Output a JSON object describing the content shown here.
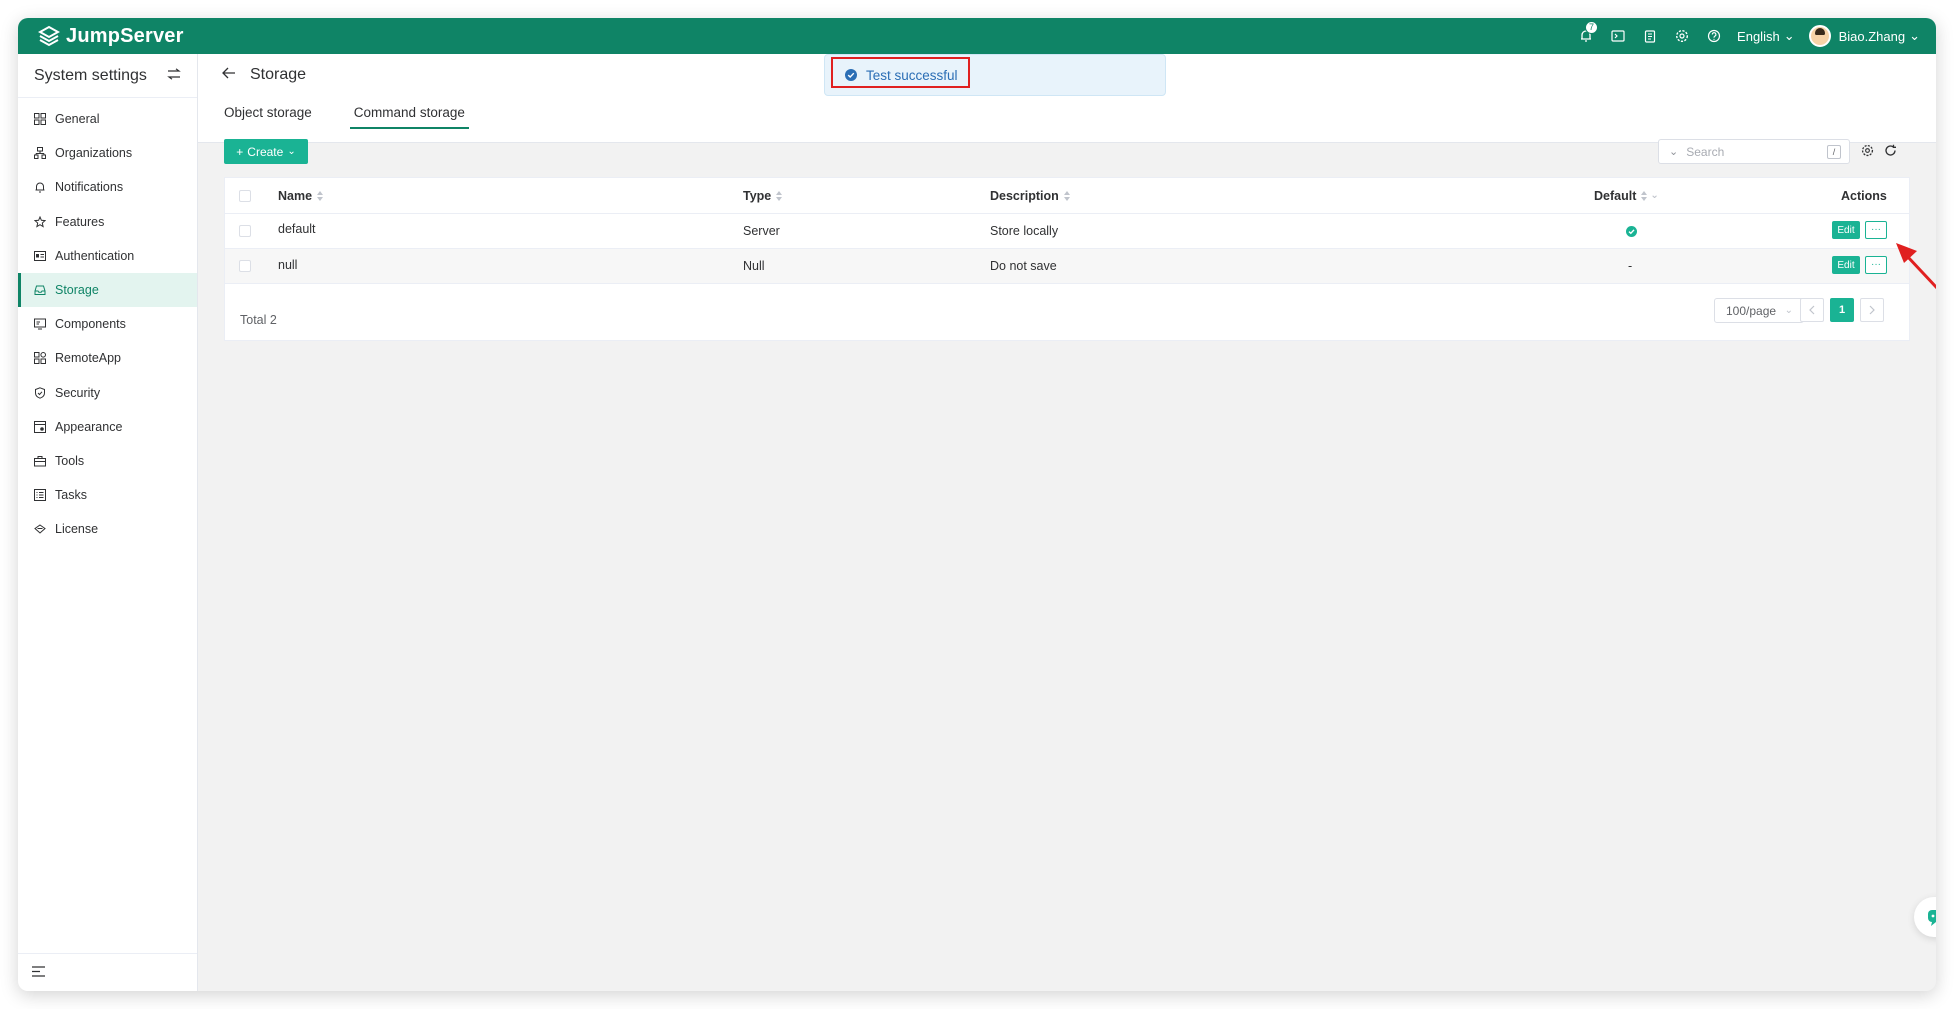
{
  "app": {
    "brand": "JumpServer",
    "notification_count": "7",
    "language": "English",
    "user": "Biao.Zhang"
  },
  "toast": {
    "message": "Test successful"
  },
  "sidebar": {
    "title": "System settings",
    "items": [
      {
        "label": "General",
        "icon": "grid-icon"
      },
      {
        "label": "Organizations",
        "icon": "org-icon"
      },
      {
        "label": "Notifications",
        "icon": "bell-icon"
      },
      {
        "label": "Features",
        "icon": "star-icon"
      },
      {
        "label": "Authentication",
        "icon": "id-card-icon"
      },
      {
        "label": "Storage",
        "icon": "storage-icon"
      },
      {
        "label": "Components",
        "icon": "monitor-icon"
      },
      {
        "label": "RemoteApp",
        "icon": "apps-icon"
      },
      {
        "label": "Security",
        "icon": "shield-icon"
      },
      {
        "label": "Appearance",
        "icon": "appearance-icon"
      },
      {
        "label": "Tools",
        "icon": "toolbox-icon"
      },
      {
        "label": "Tasks",
        "icon": "tasks-icon"
      },
      {
        "label": "License",
        "icon": "license-icon"
      }
    ]
  },
  "page": {
    "title": "Storage",
    "tabs": [
      {
        "label": "Object storage"
      },
      {
        "label": "Command storage"
      }
    ]
  },
  "toolbar": {
    "create_label": "Create",
    "search_placeholder": "Search",
    "search_shortcut": "/"
  },
  "table": {
    "columns": {
      "name": "Name",
      "type": "Type",
      "description": "Description",
      "default": "Default",
      "actions": "Actions"
    },
    "rows": [
      {
        "name": "default",
        "type": "Server",
        "description": "Store locally",
        "default": "",
        "edit": "Edit"
      },
      {
        "name": "null",
        "type": "Null",
        "description": "Do not save",
        "default": "-",
        "edit": "Edit"
      }
    ],
    "total": "Total 2",
    "page_size": "100/page",
    "current_page": "1"
  },
  "colors": {
    "primary": "#0f8466",
    "accent": "#1ab394",
    "highlight": "#e02020"
  }
}
